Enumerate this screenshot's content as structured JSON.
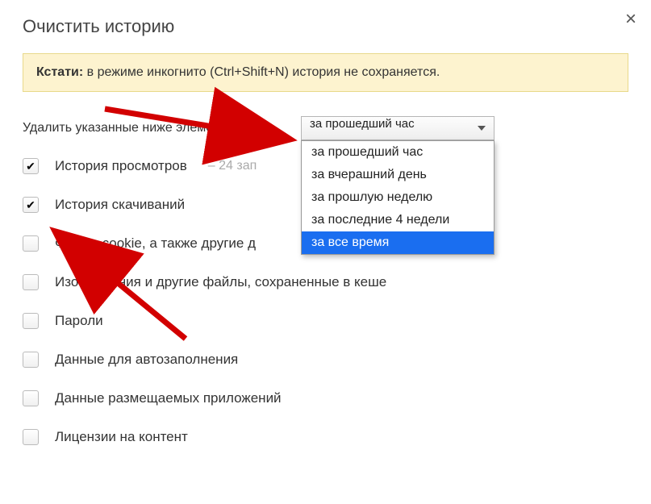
{
  "dialog": {
    "title": "Очистить историю",
    "close_glyph": "×"
  },
  "banner": {
    "prefix": "Кстати:",
    "text": " в режиме инкогнито (Ctrl+Shift+N) история не сохраняется."
  },
  "controls": {
    "label": "Удалить указанные ниже элементы"
  },
  "select": {
    "selected": "за прошедший час",
    "options": [
      {
        "label": "за прошедший час",
        "highlighted": false
      },
      {
        "label": "за вчерашний день",
        "highlighted": false
      },
      {
        "label": "за прошлую неделю",
        "highlighted": false
      },
      {
        "label": "за последние 4 недели",
        "highlighted": false
      },
      {
        "label": "за все время",
        "highlighted": true
      }
    ]
  },
  "items": [
    {
      "label": "История просмотров",
      "checked": true,
      "sub": "–  24 зап"
    },
    {
      "label": "История скачиваний",
      "checked": true,
      "sub": ""
    },
    {
      "label": "Файлы cookie, а также другие д",
      "checked": false,
      "sub": ""
    },
    {
      "label": "Изображения и другие файлы, сохраненные в кеше",
      "checked": false,
      "sub": ""
    },
    {
      "label": "Пароли",
      "checked": false,
      "sub": ""
    },
    {
      "label": "Данные для автозаполнения",
      "checked": false,
      "sub": ""
    },
    {
      "label": "Данные размещаемых приложений",
      "checked": false,
      "sub": ""
    },
    {
      "label": "Лицензии на контент",
      "checked": false,
      "sub": ""
    }
  ]
}
